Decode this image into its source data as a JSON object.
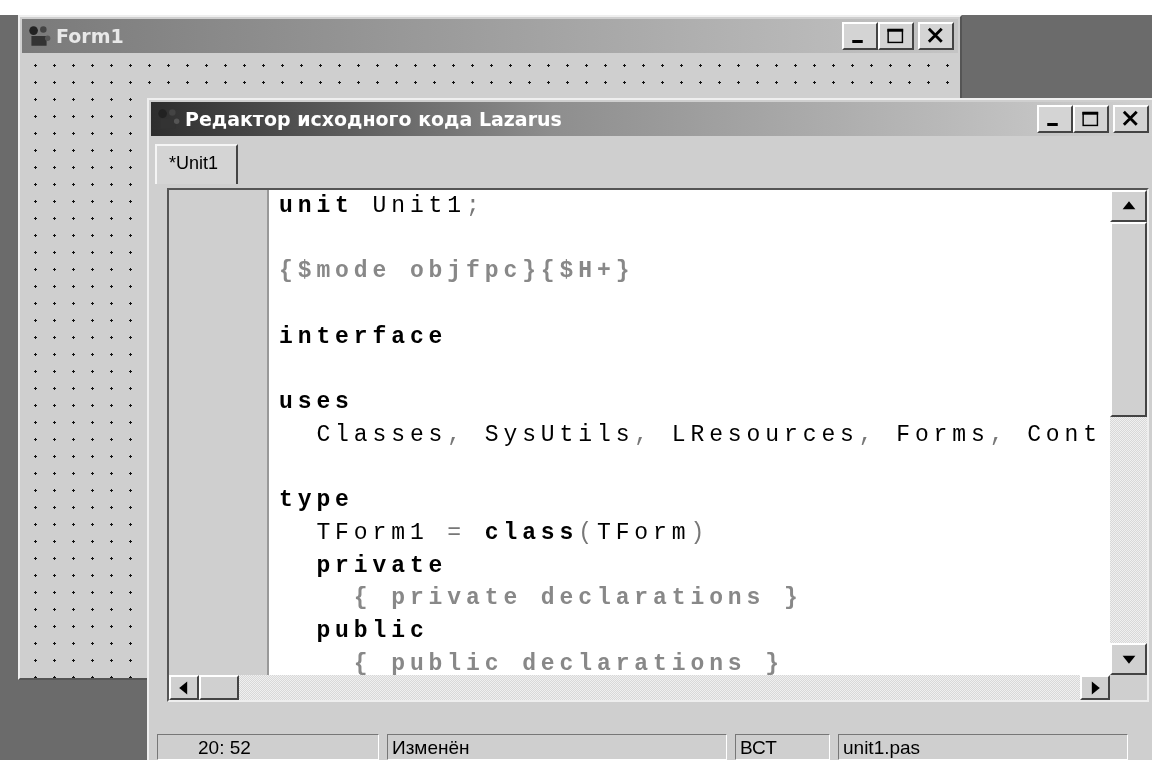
{
  "background_window": {
    "title": "Form1"
  },
  "editor": {
    "title": "Редактор исходного кода Lazarus",
    "tabs": [
      {
        "label": "*Unit1",
        "selected": true
      }
    ],
    "lines": [
      {
        "kind": "code",
        "tokens": [
          {
            "kind": "kw",
            "text": "unit"
          },
          {
            "kind": "id",
            "text": " Unit1"
          },
          {
            "kind": "sym",
            "text": ";"
          }
        ]
      },
      {
        "kind": "blank"
      },
      {
        "kind": "code",
        "tokens": [
          {
            "kind": "dir",
            "text": "{$mode objfpc}{$H+}"
          }
        ]
      },
      {
        "kind": "blank"
      },
      {
        "kind": "code",
        "tokens": [
          {
            "kind": "kw",
            "text": "interface"
          }
        ]
      },
      {
        "kind": "blank"
      },
      {
        "kind": "code",
        "tokens": [
          {
            "kind": "kw",
            "text": "uses"
          }
        ]
      },
      {
        "kind": "code",
        "tokens": [
          {
            "kind": "id",
            "text": "  Classes"
          },
          {
            "kind": "sym",
            "text": ", "
          },
          {
            "kind": "id",
            "text": "SysUtils"
          },
          {
            "kind": "sym",
            "text": ", "
          },
          {
            "kind": "id",
            "text": "LResources"
          },
          {
            "kind": "sym",
            "text": ", "
          },
          {
            "kind": "id",
            "text": "Forms"
          },
          {
            "kind": "sym",
            "text": ", "
          },
          {
            "kind": "id",
            "text": "Cont"
          }
        ]
      },
      {
        "kind": "blank"
      },
      {
        "kind": "code",
        "tokens": [
          {
            "kind": "kw",
            "text": "type"
          }
        ]
      },
      {
        "kind": "code",
        "tokens": [
          {
            "kind": "id",
            "text": "  TForm1 "
          },
          {
            "kind": "sym",
            "text": "= "
          },
          {
            "kind": "kw",
            "text": "class"
          },
          {
            "kind": "sym",
            "text": "("
          },
          {
            "kind": "id",
            "text": "TForm"
          },
          {
            "kind": "sym",
            "text": ")"
          }
        ]
      },
      {
        "kind": "code",
        "tokens": [
          {
            "kind": "kw",
            "text": "  private"
          }
        ]
      },
      {
        "kind": "code",
        "tokens": [
          {
            "kind": "comment",
            "text": "    { private declarations }"
          }
        ]
      },
      {
        "kind": "code",
        "tokens": [
          {
            "kind": "kw",
            "text": "  public"
          }
        ]
      },
      {
        "kind": "code",
        "tokens": [
          {
            "kind": "comment",
            "text": "    { public declarations }"
          }
        ]
      }
    ]
  },
  "status_bar": [
    "20: 52",
    "Изменён",
    "ВСТ",
    "unit1.pas"
  ]
}
